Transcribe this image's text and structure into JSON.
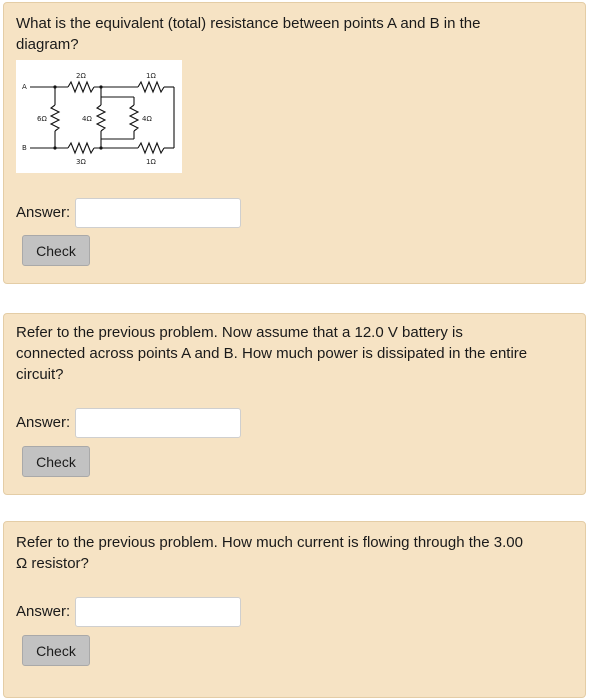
{
  "questions": [
    {
      "text": "What is the equivalent (total) resistance between points A and B in the diagram?",
      "answer_label": "Answer:",
      "answer_value": "",
      "check_label": "Check"
    },
    {
      "text": "Refer to the previous problem. Now assume that a 12.0 V battery is connected across points A and B. How much power is dissipated in the entire circuit?",
      "answer_label": "Answer:",
      "answer_value": "",
      "check_label": "Check"
    },
    {
      "text": "Refer to the previous problem. How much current is flowing through the 3.00 Ω resistor?",
      "answer_label": "Answer:",
      "answer_value": "",
      "check_label": "Check"
    }
  ],
  "diagram": {
    "point_a": "A",
    "point_b": "B",
    "r_top_left": "2Ω",
    "r_top_right": "1Ω",
    "r_left": "6Ω",
    "r_mid": "4Ω",
    "r_right": "4Ω",
    "r_bottom_left": "3Ω",
    "r_bottom_right": "1Ω"
  },
  "colors": {
    "card_background": "#f6e3c4",
    "card_border": "#e4cda6",
    "button": "#c2c2c2"
  }
}
